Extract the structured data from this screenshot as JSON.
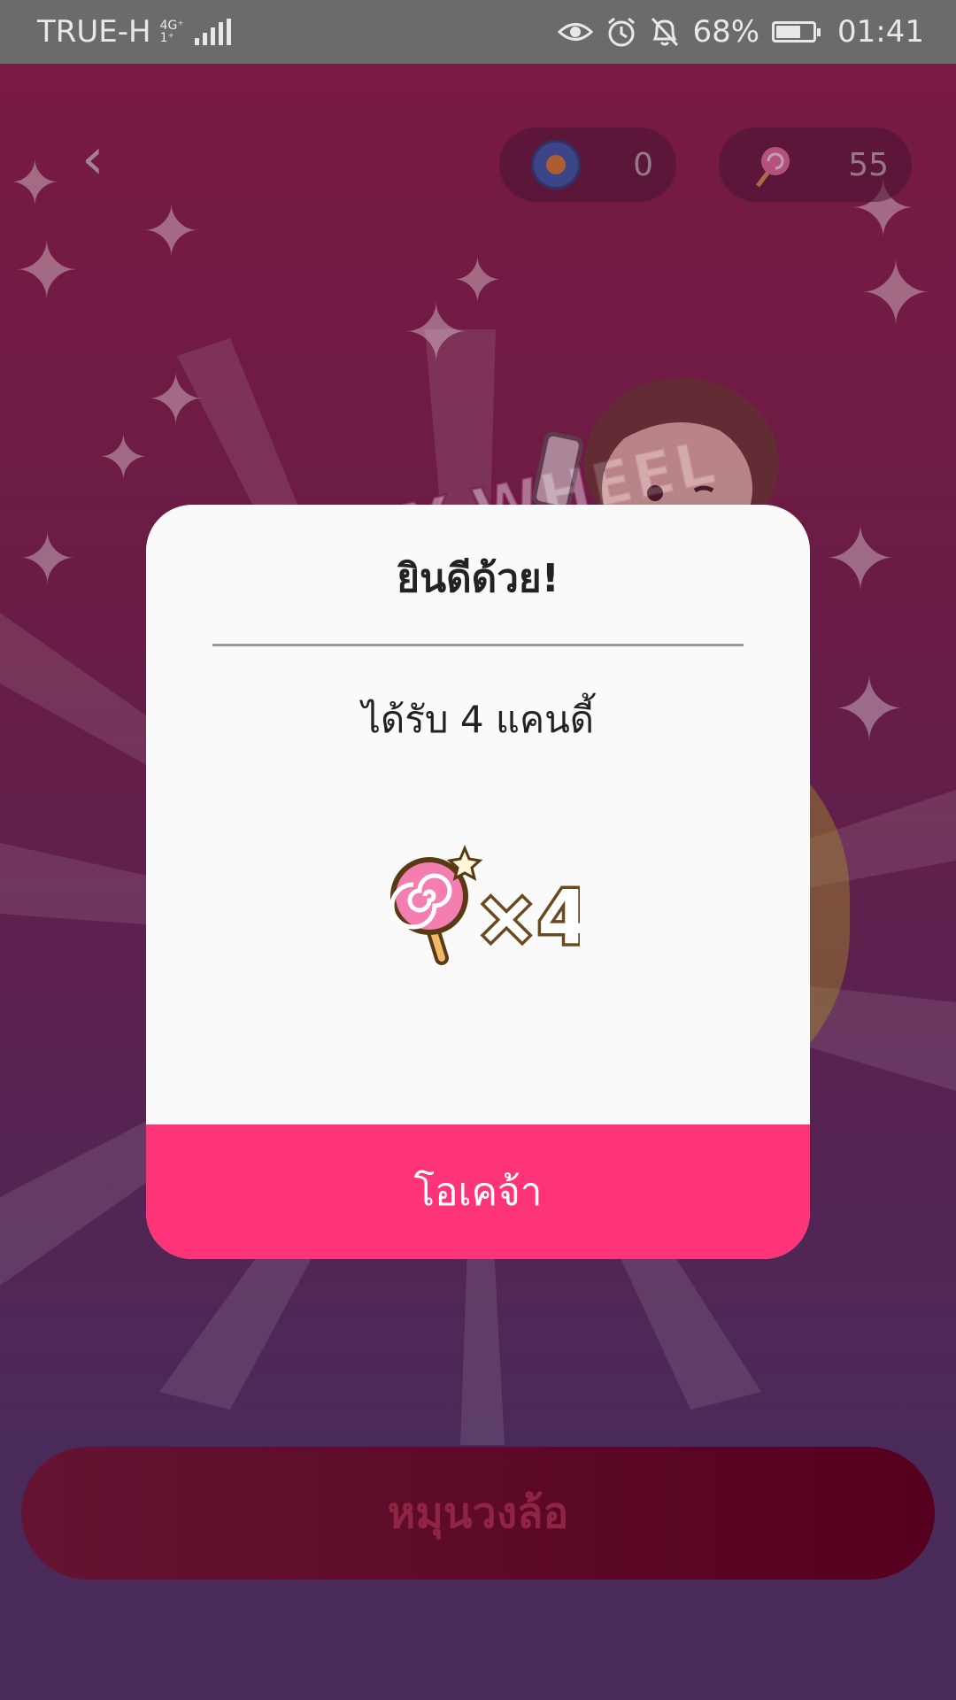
{
  "status_bar": {
    "carrier": "TRUE-H",
    "network_top": "4G⁺",
    "network_bottom": "1⁺",
    "battery": "68%",
    "battery_level": 0.68,
    "time": "01:41"
  },
  "header": {
    "coin_count": "0",
    "candy_count": "55"
  },
  "background": {
    "wheel_title": "CANDY WHEEL",
    "spin_button": "หมุนวงล้อ"
  },
  "dialog": {
    "title": "ยินดีด้วย!",
    "message": "ได้รับ 4 แคนดี้",
    "reward_multiplier": "×4",
    "ok_button": "โอเคจ้า"
  },
  "colors": {
    "accent": "#ff3377",
    "dialog_bg": "#fafafa"
  }
}
